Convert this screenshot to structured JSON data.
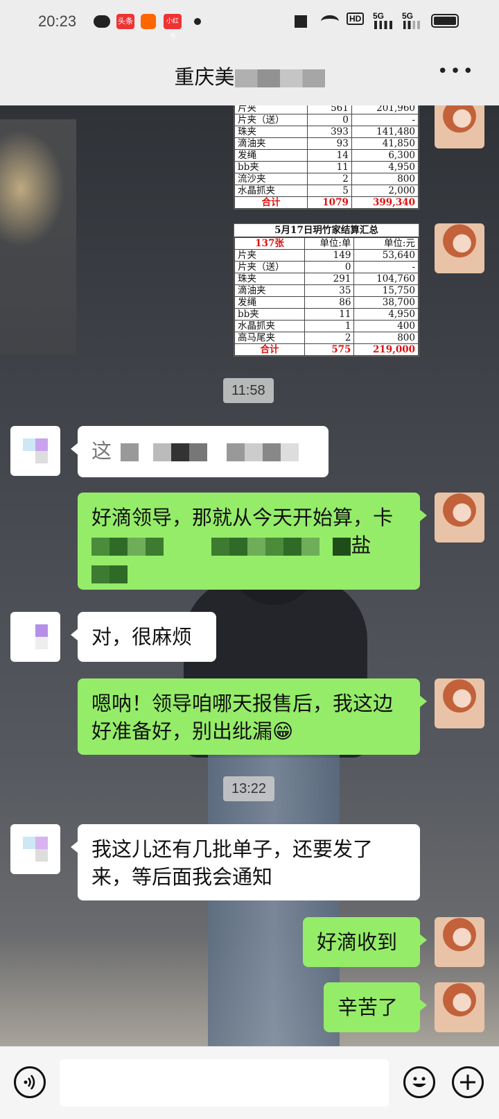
{
  "status": {
    "time": "20:23",
    "apps": [
      "头条",
      "小红书"
    ],
    "network": "5G",
    "hd": "HD"
  },
  "header": {
    "title_visible": "重庆美",
    "more_icon": "more-dots-icon"
  },
  "sheet1": {
    "rows": [
      {
        "name": "片夹",
        "qty": "561",
        "amount": "201,960"
      },
      {
        "name": "片夹（送）",
        "qty": "0",
        "amount": "-"
      },
      {
        "name": "珠夹",
        "qty": "393",
        "amount": "141,480"
      },
      {
        "name": "滴油夹",
        "qty": "93",
        "amount": "41,850"
      },
      {
        "name": "发绳",
        "qty": "14",
        "amount": "6,300"
      },
      {
        "name": "bb夹",
        "qty": "11",
        "amount": "4,950"
      },
      {
        "name": "流沙夹",
        "qty": "2",
        "amount": "800"
      },
      {
        "name": "水晶抓夹",
        "qty": "5",
        "amount": "2,000"
      }
    ],
    "total": {
      "name": "合计",
      "qty": "1079",
      "amount": "399,340"
    }
  },
  "sheet2": {
    "caption": "5月17日玥竹家结算汇总",
    "header": {
      "count": "137张",
      "unit_qty": "单位:单",
      "unit_amount": "单位:元"
    },
    "rows": [
      {
        "name": "片夹",
        "qty": "149",
        "amount": "53,640"
      },
      {
        "name": "片夹（送）",
        "qty": "0",
        "amount": "-"
      },
      {
        "name": "珠夹",
        "qty": "291",
        "amount": "104,760"
      },
      {
        "name": "滴油夹",
        "qty": "35",
        "amount": "15,750"
      },
      {
        "name": "发绳",
        "qty": "86",
        "amount": "38,700"
      },
      {
        "name": "bb夹",
        "qty": "11",
        "amount": "4,950"
      },
      {
        "name": "水晶抓夹",
        "qty": "1",
        "amount": "400"
      },
      {
        "name": "高马尾夹",
        "qty": "2",
        "amount": "800"
      }
    ],
    "total": {
      "name": "合计",
      "qty": "575",
      "amount": "219,000"
    }
  },
  "messages": {
    "ts1": "11:58",
    "m1_left": "这",
    "m2_right_a": "好滴领导，那就从今天开始算，卡",
    "m2_right_tail": "盐",
    "m3_left": "对，很麻烦",
    "m4_right": "嗯呐！领导咱哪天报售后，我这边好准备好，别出纰漏😁",
    "ts2": "13:22",
    "m5_left": "我这儿还有几批单子，还要发了来，等后面我会通知",
    "m6_right": "好滴收到",
    "m7_right": "辛苦了"
  },
  "inputbar": {
    "voice_icon": "voice-icon",
    "emoji_icon": "emoji-icon",
    "plus_icon": "plus-icon"
  }
}
